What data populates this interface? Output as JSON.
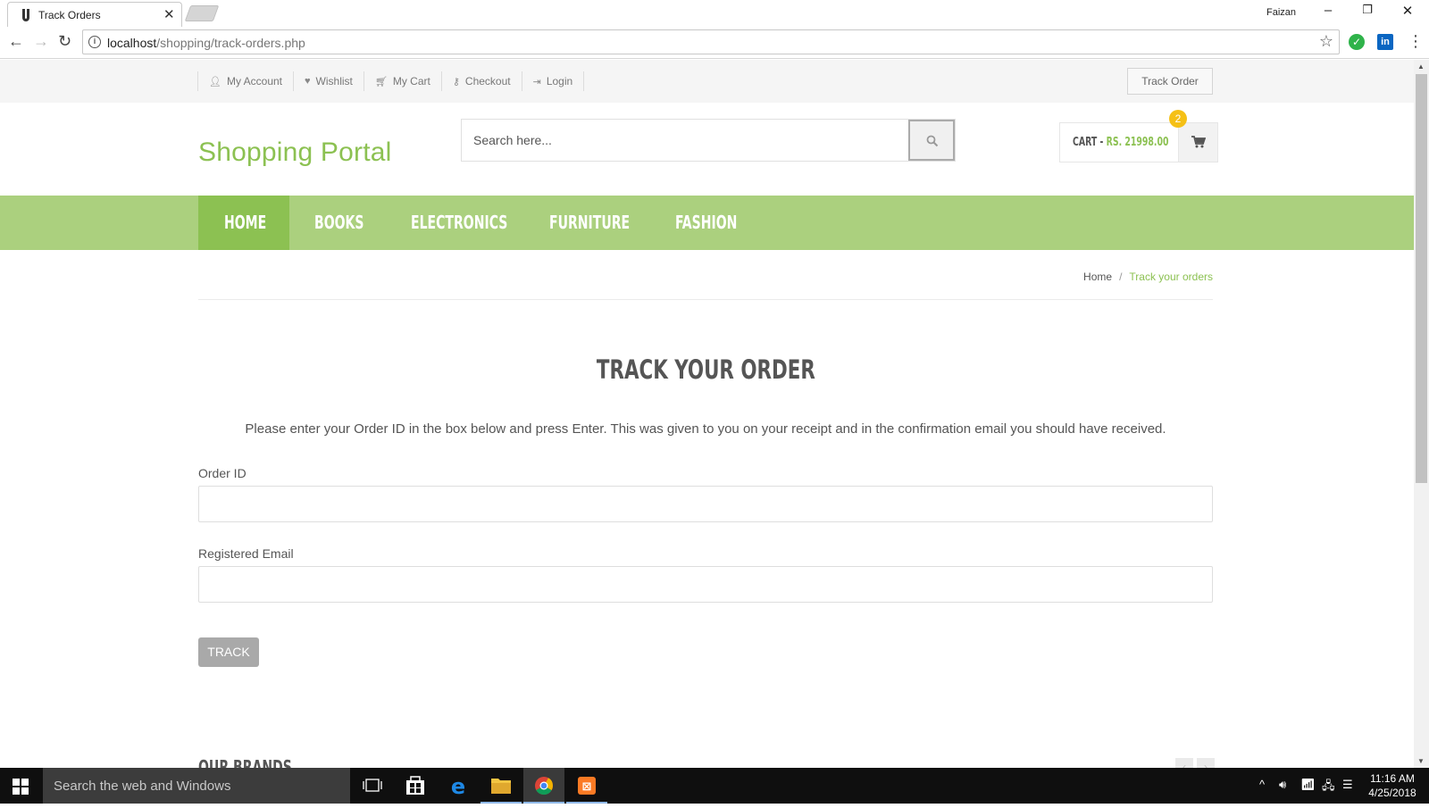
{
  "browser": {
    "tab_title": "Track Orders",
    "profile_name": "Faizan",
    "url_host": "localhost",
    "url_path": "/shopping/track-orders.php"
  },
  "topbar": {
    "links": [
      {
        "label": "My Account",
        "icon": "user-icon"
      },
      {
        "label": "Wishlist",
        "icon": "heart-icon"
      },
      {
        "label": "My Cart",
        "icon": "cart-icon"
      },
      {
        "label": "Checkout",
        "icon": "key-icon"
      },
      {
        "label": "Login",
        "icon": "sign-in-icon"
      }
    ],
    "track_order_label": "Track Order"
  },
  "header": {
    "logo": "Shopping Portal",
    "search_placeholder": "Search here...",
    "cart_label": "CART - ",
    "cart_total": "RS. 21998.00",
    "cart_count": "2"
  },
  "nav": {
    "items": [
      "HOME",
      "BOOKS",
      "ELECTRONICS",
      "FURNITURE",
      "FASHION"
    ],
    "active": "HOME"
  },
  "breadcrumb": {
    "home": "Home",
    "separator": "/",
    "current": "Track your orders"
  },
  "main": {
    "heading": "TRACK YOUR ORDER",
    "intro": "Please enter your Order ID in the box below and press Enter. This was given to you on your receipt and in the confirmation email you should have received.",
    "order_id_label": "Order ID",
    "order_id_value": "",
    "email_label": "Registered Email",
    "email_value": "",
    "track_button": "TRACK",
    "brands_title": "OUR BRANDS"
  },
  "taskbar": {
    "search_text": "Search the web and Windows",
    "time": "11:16 AM",
    "date": "4/25/2018"
  },
  "colors": {
    "accent": "#8cc152",
    "nav_bg": "#abd07e",
    "badge": "#f5c016",
    "button_gray": "#a9a9a9"
  }
}
